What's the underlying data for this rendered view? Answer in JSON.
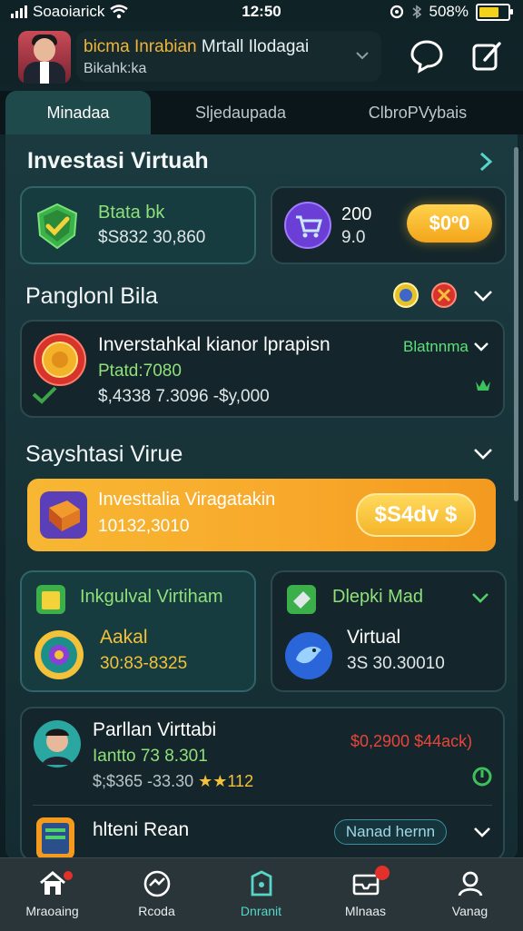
{
  "status": {
    "carrier": "Soaoiarick",
    "time": "12:50",
    "battery": "508%",
    "battery_level": 0.8
  },
  "header": {
    "user_name_highlight": "bicma Inrabian",
    "user_name_rest": "Mrtall Ilodagai",
    "user_sub": "Bikahk:ka"
  },
  "tabs": [
    {
      "label": "Minadaa",
      "active": true
    },
    {
      "label": "Sljedaupada",
      "active": false
    },
    {
      "label": "ClbroPVybais",
      "active": false
    }
  ],
  "investasi": {
    "title": "Investasi Virtuah",
    "card1": {
      "title": "Btata bk",
      "value": "$S832 30,860"
    },
    "card2": {
      "line1": "200",
      "line2": "9.0",
      "button": "$0º0"
    }
  },
  "panel2": {
    "title": "Panglonl Bila",
    "card": {
      "title": "Inverstahkal kianor lprapisn",
      "subtitle": "Ptatd:7080",
      "value": "$,4338 7.3096 -$y,000",
      "tag": "Blatnnma"
    }
  },
  "sayshtasi": {
    "title": "Sayshtasi Virue",
    "banner_title": "Investtalia Viragatakin",
    "banner_value": "10132,3010",
    "banner_button": "$S4dv $"
  },
  "grid": [
    {
      "title": "Inkgulval Virtiham",
      "label": "Aakal",
      "value": "30:83-8325"
    },
    {
      "title": "Dlepki Mad",
      "label": "Virtual",
      "value": "3S 30.30010"
    }
  ],
  "list": [
    {
      "title": "Parllan Virttabi",
      "subtitle": "Iantto 73 8.301",
      "meta": "$;$365 -33.30",
      "stars": "★★112",
      "amount": "$0,2900 $44ack)"
    },
    {
      "title": "hlteni Rean",
      "tag": "Nanad hernn"
    }
  ],
  "nav": [
    {
      "label": "Mraoaing",
      "icon": "home-icon"
    },
    {
      "label": "Rcoda",
      "icon": "trade-icon"
    },
    {
      "label": "Dnranit",
      "icon": "wallet-icon",
      "active": true
    },
    {
      "label": "Mlnaas",
      "icon": "inbox-icon"
    },
    {
      "label": "Vanag",
      "icon": "profile-icon"
    }
  ],
  "colors": {
    "accent_teal": "#56d6c8",
    "gold": "#f4b52a",
    "green": "#4fd26b",
    "red": "#e8443a"
  }
}
